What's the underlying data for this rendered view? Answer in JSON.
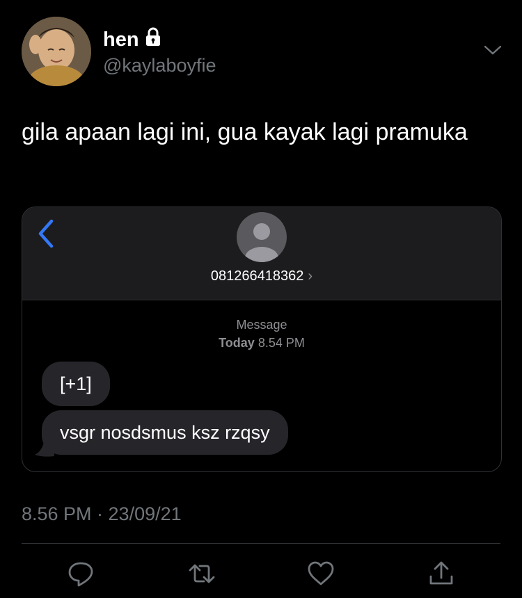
{
  "author": {
    "display_name": "hen",
    "handle": "@kaylaboyfie",
    "protected_icon": "lock-icon"
  },
  "tweet": {
    "text": "gila apaan lagi ini, gua kayak lagi pramuka",
    "timestamp": "8.56 PM · 23/09/21"
  },
  "embedded_screenshot": {
    "contact_number": "081266418362",
    "chevron": "›",
    "header_label": "Message",
    "date_label_bold": "Today",
    "date_label_time": "8.54 PM",
    "messages": [
      "[+1]",
      "vsgr nosdsmus ksz rzqsy"
    ],
    "accent_color": "#3478f6"
  },
  "actions": {
    "icons": [
      "reply-icon",
      "retweet-icon",
      "like-icon",
      "share-icon"
    ]
  },
  "colors": {
    "background": "#000000",
    "secondary_text": "#71767b",
    "bubble": "#26252a"
  }
}
